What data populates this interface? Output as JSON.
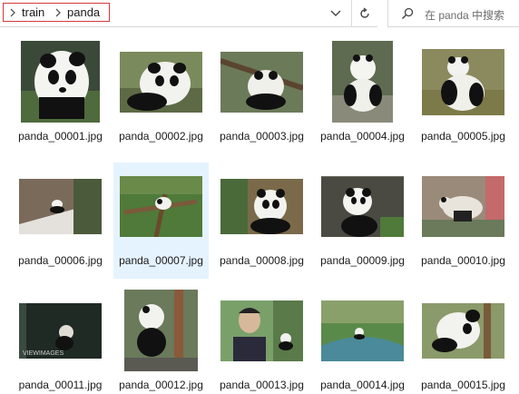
{
  "breadcrumb": {
    "items": [
      "train",
      "panda"
    ]
  },
  "search": {
    "placeholder": "在 panda 中搜索"
  },
  "files": [
    {
      "name": "panda_00001.jpg"
    },
    {
      "name": "panda_00002.jpg"
    },
    {
      "name": "panda_00003.jpg"
    },
    {
      "name": "panda_00004.jpg"
    },
    {
      "name": "panda_00005.jpg"
    },
    {
      "name": "panda_00006.jpg"
    },
    {
      "name": "panda_00007.jpg"
    },
    {
      "name": "panda_00008.jpg"
    },
    {
      "name": "panda_00009.jpg"
    },
    {
      "name": "panda_00010.jpg"
    },
    {
      "name": "panda_00011.jpg"
    },
    {
      "name": "panda_00012.jpg"
    },
    {
      "name": "panda_00013.jpg"
    },
    {
      "name": "panda_00014.jpg"
    },
    {
      "name": "panda_00015.jpg"
    }
  ],
  "watermark": "VIEWIMAGES"
}
